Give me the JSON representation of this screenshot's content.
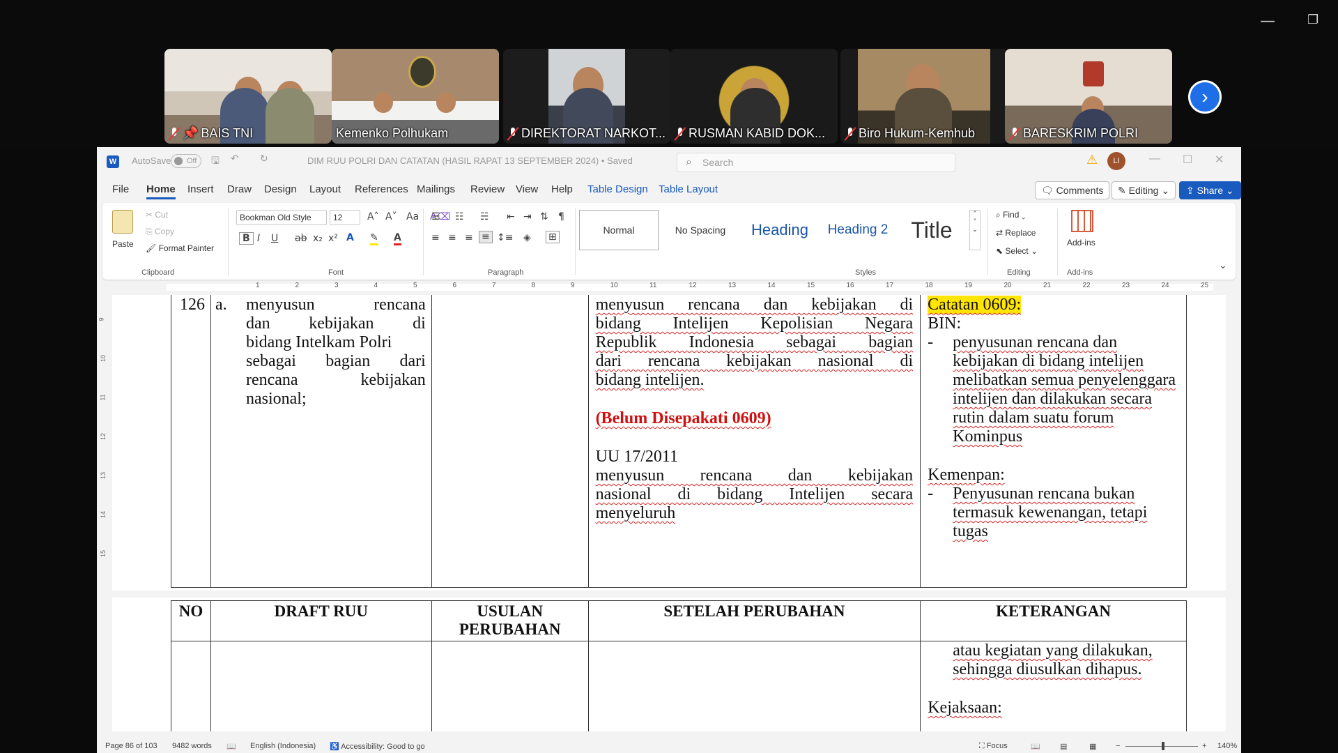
{
  "meeting": {
    "participants": [
      {
        "name": "BAIS TNI",
        "pinned": true,
        "active": false
      },
      {
        "name": "Kemenko Polhukam",
        "pinned": false,
        "active": true
      },
      {
        "name": "DIREKTORAT NARKOT...",
        "pinned": false,
        "active": false
      },
      {
        "name": "RUSMAN KABID DOK...",
        "pinned": false,
        "active": false
      },
      {
        "name": "Biro Hukum-Kemhub",
        "pinned": false,
        "active": false
      },
      {
        "name": "BARESKRIM POLRI",
        "pinned": false,
        "active": false
      }
    ],
    "next_icon": "chevron-right-icon"
  },
  "word": {
    "autosave_label": "AutoSave",
    "autosave_state": "Off",
    "doc_title": "DIM RUU POLRI DAN CATATAN (HASIL RAPAT 13 SEPTEMBER 2024) • Saved",
    "search_placeholder": "Search",
    "user_initials": "LI",
    "menu": [
      "File",
      "Home",
      "Insert",
      "Draw",
      "Design",
      "Layout",
      "References",
      "Mailings",
      "Review",
      "View",
      "Help",
      "Table Design",
      "Table Layout"
    ],
    "active_menu": "Home",
    "comments_label": "Comments",
    "editing_label": "Editing",
    "share_label": "Share",
    "ribbon": {
      "clipboard": {
        "paste": "Paste",
        "cut": "Cut",
        "copy": "Copy",
        "format_painter": "Format Painter",
        "group": "Clipboard"
      },
      "font": {
        "name": "Bookman Old Style",
        "size": "12",
        "group": "Font"
      },
      "paragraph": {
        "group": "Paragraph"
      },
      "styles": {
        "items": [
          "Normal",
          "No Spacing",
          "Heading",
          "Heading 2",
          "Title"
        ],
        "group": "Styles"
      },
      "editing": {
        "find": "Find",
        "replace": "Replace",
        "select": "Select",
        "group": "Editing"
      },
      "addins": {
        "label": "Add-ins",
        "group": "Add-ins"
      }
    },
    "ruler_numbers": [
      "1",
      "2",
      "3",
      "4",
      "5",
      "6",
      "7",
      "8",
      "9",
      "10",
      "11",
      "12",
      "13",
      "14",
      "15",
      "16",
      "17",
      "18",
      "19",
      "20",
      "21",
      "22",
      "23",
      "24",
      "25"
    ],
    "vruler_numbers": [
      "9",
      "10",
      "11",
      "12",
      "13",
      "14",
      "15"
    ],
    "document": {
      "row": {
        "no": "126",
        "letter": "a.",
        "draft_lines": [
          "menyusun rencana",
          "dan kebijakan di",
          "bidang Intelkam Polri",
          "sebagai bagian dari",
          "rencana kebijakan",
          "nasional;"
        ],
        "setelah_lines_1": [
          "menyusun rencana dan kebijakan di",
          "bidang Intelijen Kepolisian Negara",
          "Republik Indonesia sebagai bagian",
          "dari rencana kebijakan nasional di",
          "bidang intelijen."
        ],
        "belum": "(Belum Disepakati 0609)",
        "uu": "UU 17/2011",
        "setelah_lines_2": [
          "menyusun rencana dan kebijakan",
          "nasional di bidang Intelijen secara",
          "menyeluruh"
        ],
        "catatan": "Catatan 0609:",
        "bin_label": "BIN:",
        "bin_text": "penyusunan rencana dan kebijakan di bidang intelijen melibatkan semua penyelenggara intelijen dan dilakukan secara rutin dalam suatu forum Kominpus",
        "kemenpan_label": "Kemenpan:",
        "kemenpan_text": "Penyusunan rencana bukan termasuk kewenangan, tetapi tugas"
      },
      "headers": [
        "NO",
        "DRAFT RUU",
        "USULAN PERUBAHAN",
        "SETELAH PERUBAHAN",
        "KETERANGAN"
      ],
      "continued_text": "atau kegiatan yang dilakukan, sehingga diusulkan dihapus.",
      "kejaksaan_label": "Kejaksaan:"
    },
    "status": {
      "page": "Page 86 of 103",
      "words": "9482 words",
      "language": "English (Indonesia)",
      "accessibility": "Accessibility: Good to go",
      "focus": "Focus",
      "zoom": "140%"
    }
  }
}
